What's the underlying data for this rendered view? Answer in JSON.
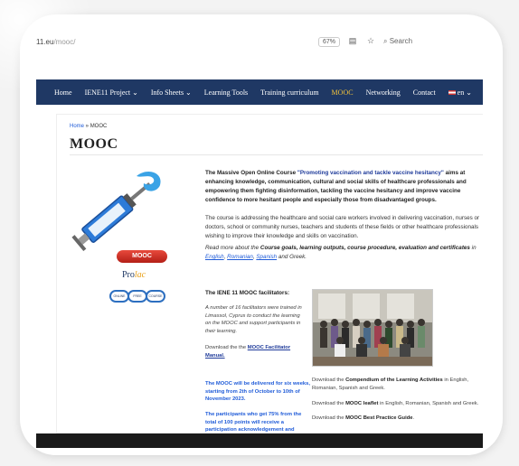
{
  "browser": {
    "url_main": "11.eu",
    "url_path": "/mooc/",
    "zoom": "67%",
    "search_placeholder": "Search",
    "reader_icon": "reader-icon",
    "bookmark_icon": "star-icon"
  },
  "nav": {
    "items": [
      "Home",
      "IENE11 Project ⌄",
      "Info Sheets ⌄",
      "Learning Tools",
      "Training curriculum",
      "MOOC",
      "Networking",
      "Contact",
      "en ⌄"
    ],
    "active_index": 5,
    "bg": "#1f3864",
    "active_color": "#f0c23b"
  },
  "breadcrumb": {
    "home": "Home",
    "sep": " » ",
    "current": "MOOC"
  },
  "page_title": "MOOC",
  "intro": {
    "lead": "The   Massive Open Online Course ",
    "course_name": "\"Promoting vaccination and tackle vaccine hesitancy\"",
    "rest": " aims at enhancing knowledge, communication, cultural and social skills of healthcare professionals and  empowering them fighting disinformation, tackling the vaccine hesitancy and improve vaccine confidence to more hesitant people and especially those from disadvantaged groups."
  },
  "para2": "The course is addressing the healthcare and social care workers involved in delivering vaccination, nurses or doctors, school or community nurses, teachers and students of these fields or other healthcare professionals wishing to improve their knowledge and skills on vaccination.",
  "para3": {
    "lead": "Read more about the ",
    "topics": "Course goals, learning outputs, course procedure, evaluation and certificates",
    "in": " in ",
    "english": "English",
    "romanian": "Romanian",
    "spanish": "Spanish",
    "greek_end": " and Greek."
  },
  "facilitators": {
    "heading": "The IENE 11 MOOC facilitators:",
    "text": "A number of 16  facilitators were trained in Limassol, Cyprus to conduct the learning on the MOOC and support participants in their learning.",
    "download_lead": "Download the   the ",
    "manual_link": "MOOC Facilitator Manual."
  },
  "logo": {
    "badge": "MOOC",
    "prolac": "Pro",
    "prolac_accent": "lac",
    "chain": [
      "ONLINE",
      "FREE",
      "COURSE"
    ]
  },
  "notes": {
    "delivery": "The MOOC will be delivered for six weeks, starting from  2th of October  to 10th of November 2023.",
    "certificate": "The participants who get 75% from the total of 100 points  will receive a participation acknowledgement and Certificate."
  },
  "downloads": {
    "compendium": {
      "lead": "Download the ",
      "bold": "Compendium of the  Learning Activities",
      "tail": " in English, Romanian, Spanish and Greek."
    },
    "leaflet": {
      "lead": "Download the  ",
      "bold": "MOOC leaflet",
      "tail": " in English, Romanian, Spanish and Greek."
    },
    "guide": {
      "lead": "Download the ",
      "bold": "MOOC  Best Practice Guide",
      "tail": "."
    }
  }
}
